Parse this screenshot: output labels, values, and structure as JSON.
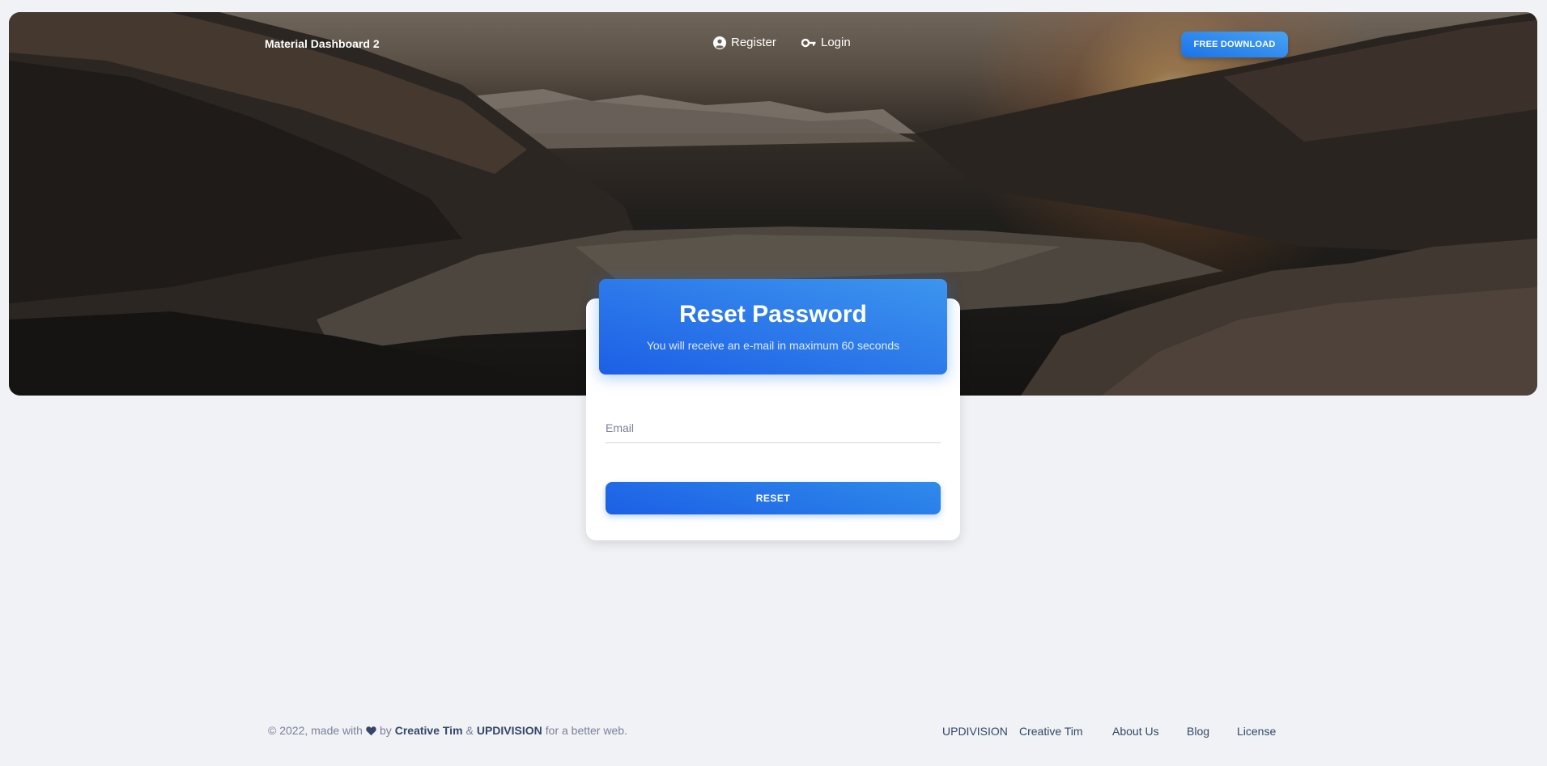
{
  "navbar": {
    "brand": "Material Dashboard 2",
    "register_label": "Register",
    "login_label": "Login",
    "download_label": "FREE DOWNLOAD",
    "register_icon": "user-circle-icon",
    "login_icon": "key-icon"
  },
  "card": {
    "title": "Reset Password",
    "subtitle": "You will receive an e-mail in maximum 60 seconds",
    "email_placeholder": "Email",
    "email_value": "",
    "reset_label": "RESET"
  },
  "footer": {
    "copyright_prefix": "© 2022, made with",
    "by_text": "by",
    "author1": "Creative Tim",
    "ampersand": "&",
    "author2": "UPDIVISION",
    "suffix": "for a better web.",
    "heart_icon": "heart-icon",
    "links": [
      "UPDIVISION",
      "Creative Tim",
      "About Us",
      "Blog",
      "License"
    ]
  },
  "colors": {
    "primary": "#1a73e8",
    "background": "#f0f2f5",
    "text": "#344767",
    "muted": "#7b809a"
  }
}
